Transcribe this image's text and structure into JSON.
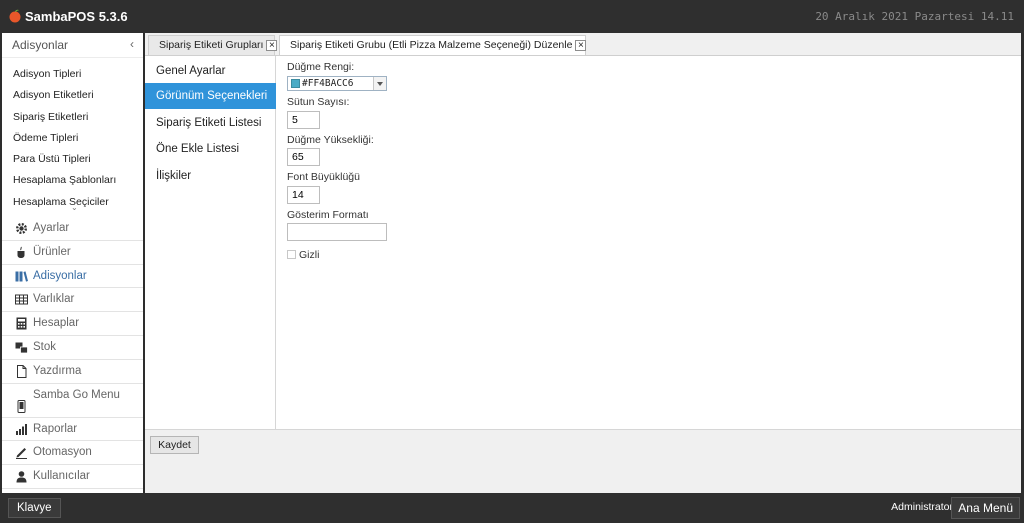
{
  "app": {
    "title": "SambaPOS 5.3.6",
    "date_text": "20 Aralık 2021 Pazartesi 14.11"
  },
  "sidebar": {
    "header": "Adisyonlar",
    "collapse_glyph": "‹",
    "sub_items": [
      "Adisyon Tipleri",
      "Adisyon Etiketleri",
      "Sipariş Etiketleri",
      "Ödeme Tipleri",
      "Para Üstü Tipleri",
      "Hesaplama Şablonları",
      "Hesaplama Seçiciler"
    ],
    "scroll_glyph": "⌄",
    "menu": [
      {
        "label": "Ayarlar",
        "icon": "gear-icon"
      },
      {
        "label": "Ürünler",
        "icon": "cup-icon"
      },
      {
        "label": "Adisyonlar",
        "icon": "books-icon",
        "active": true
      },
      {
        "label": "Varlıklar",
        "icon": "table-icon"
      },
      {
        "label": "Hesaplar",
        "icon": "calculator-icon"
      },
      {
        "label": "Stok",
        "icon": "stock-icon"
      },
      {
        "label": "Yazdırma",
        "icon": "document-icon"
      },
      {
        "label": "Samba Go Menu",
        "icon": "mobile-icon"
      },
      {
        "label": "Raporlar",
        "icon": "bar-chart-icon"
      },
      {
        "label": "Otomasyon",
        "icon": "pen-icon"
      },
      {
        "label": "Kullanıcılar",
        "icon": "user-icon"
      }
    ]
  },
  "tabs": [
    {
      "label": "Sipariş Etiketi Grupları",
      "close": "×"
    },
    {
      "label": "Sipariş Etiketi Grubu (Etli Pizza Malzeme Seçeneği) Düzenle",
      "close": "×",
      "active": true
    }
  ],
  "subnav": [
    {
      "label": "Genel Ayarlar"
    },
    {
      "label": "Görünüm Seçenekleri",
      "active": true
    },
    {
      "label": "Sipariş Etiketi Listesi"
    },
    {
      "label": "Öne Ekle Listesi"
    },
    {
      "label": "İlişkiler"
    }
  ],
  "form": {
    "button_color_label": "Düğme Rengi:",
    "button_color_value": "#FF4BACC6",
    "button_color_swatch": "#4BACC6",
    "column_count_label": "Sütun Sayısı:",
    "column_count_value": "5",
    "button_height_label": "Düğme Yüksekliği:",
    "button_height_value": "65",
    "font_size_label": "Font Büyüklüğü",
    "font_size_value": "14",
    "display_format_label": "Gösterim Formatı",
    "display_format_value": "",
    "hidden_label": "Gizli",
    "hidden_checked": false
  },
  "actions": {
    "save_label": "Kaydet"
  },
  "bottom": {
    "keyboard_label": "Klavye",
    "user_name": "Administrator",
    "main_menu_label": "Ana Menü"
  }
}
